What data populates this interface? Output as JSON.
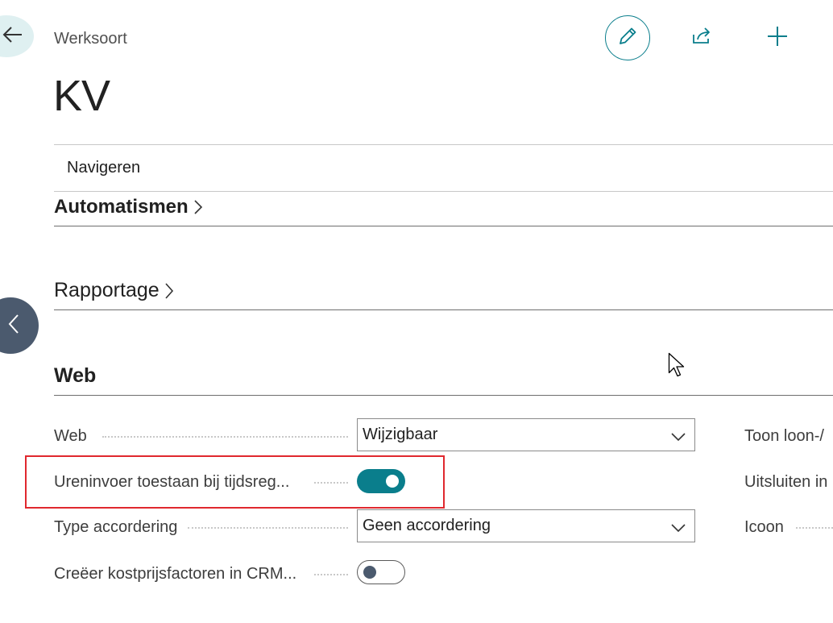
{
  "header": {
    "breadcrumb": "Werksoort",
    "title": "KV",
    "actions": {
      "edit_icon": "pencil-icon",
      "share_icon": "share-icon",
      "add_icon": "plus-icon"
    }
  },
  "nav": {
    "label": "Navigeren"
  },
  "sections": {
    "automatismen": "Automatismen",
    "rapportage": "Rapportage",
    "web": "Web"
  },
  "fields_left": {
    "web": {
      "label": "Web",
      "value": "Wijzigbaar"
    },
    "ureninvoer": {
      "label": "Ureninvoer toestaan bij tijdsreg...",
      "value": true
    },
    "type_accordering": {
      "label": "Type accordering",
      "value": "Geen accordering"
    },
    "creeer": {
      "label": "Creëer kostprijsfactoren in CRM...",
      "value": false
    }
  },
  "fields_right": {
    "toon": {
      "label": "Toon loon-/"
    },
    "uitsluiten": {
      "label": "Uitsluiten in"
    },
    "icoon": {
      "label": "Icoon"
    }
  },
  "colors": {
    "accent": "#0a7e8c",
    "highlight": "#e0282e",
    "side_toggle": "#4b5a6e"
  }
}
